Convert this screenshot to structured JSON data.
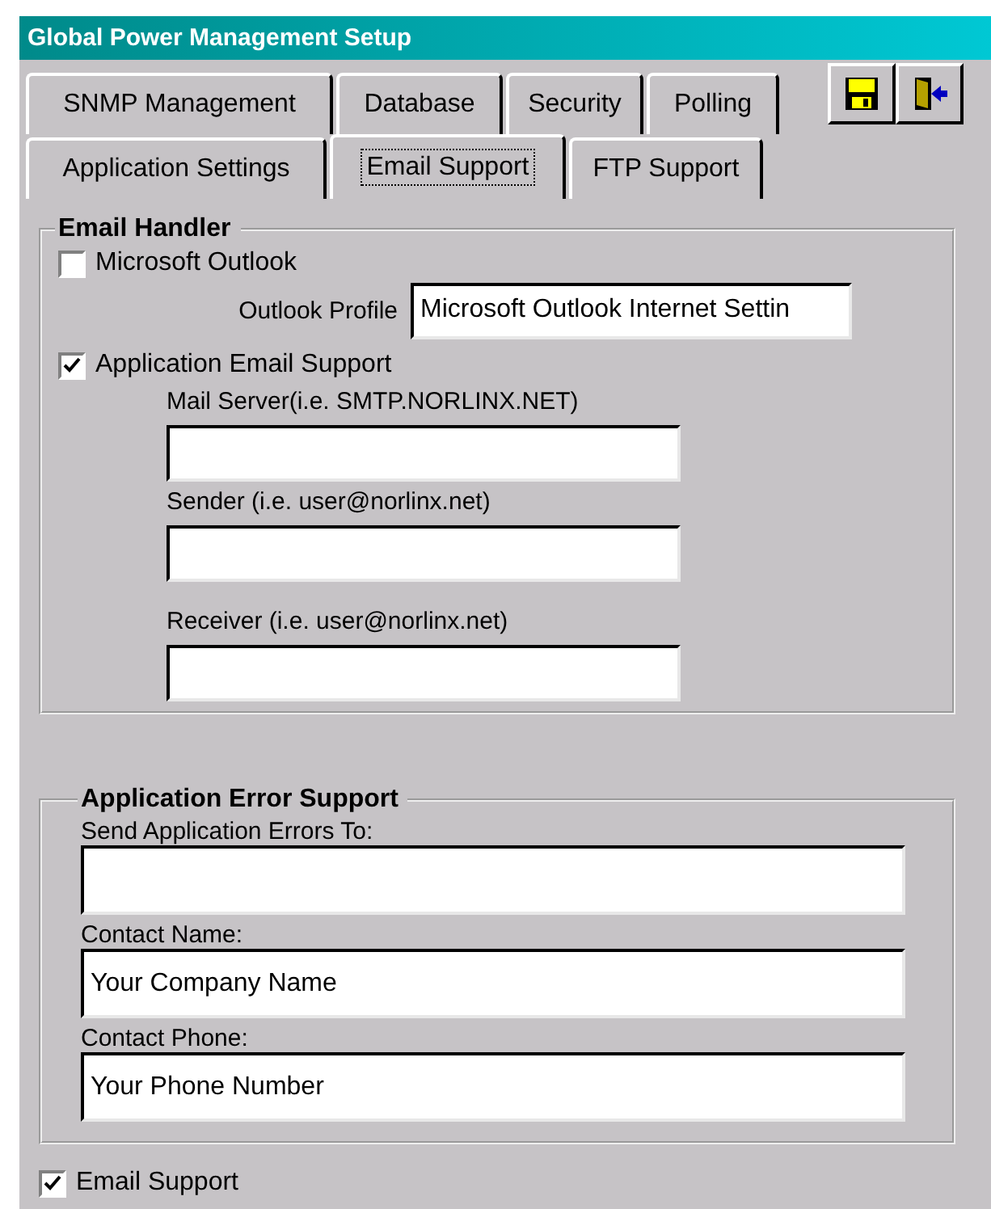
{
  "window": {
    "title": "Global Power Management Setup"
  },
  "tab_rows": [
    {
      "tabs": [
        {
          "label": "SNMP Management",
          "selected": false
        },
        {
          "label": "Database",
          "selected": false
        },
        {
          "label": "Security",
          "selected": false
        },
        {
          "label": "Polling",
          "selected": false
        }
      ]
    },
    {
      "tabs": [
        {
          "label": "Application Settings",
          "selected": false
        },
        {
          "label": "Email Support",
          "selected": true
        },
        {
          "label": "FTP Support",
          "selected": false
        }
      ]
    }
  ],
  "email_handler": {
    "title": "Email Handler",
    "microsoft_outlook": {
      "label": "Microsoft Outlook",
      "checked": false
    },
    "outlook_profile": {
      "label": "Outlook Profile",
      "value": "Microsoft Outlook Internet Settin"
    },
    "application_email": {
      "label": "Application Email Support",
      "checked": true
    },
    "fields": [
      {
        "label": "Mail Server(i.e. SMTP.NORLINX.NET)"
      },
      {
        "label": "Sender (i.e. user@norlinx.net)"
      },
      {
        "label": "Receiver (i.e. user@norlinx.net)"
      }
    ]
  },
  "error_support": {
    "title": "Application Error Support",
    "fields": [
      {
        "label": "Send Application Errors To:"
      },
      {
        "label": "Contact Name:",
        "value": "Your Company Name"
      },
      {
        "label": "Contact Phone:",
        "value": "Your Phone Number"
      }
    ]
  },
  "email_support": {
    "label": "Email Support",
    "checked": true
  }
}
